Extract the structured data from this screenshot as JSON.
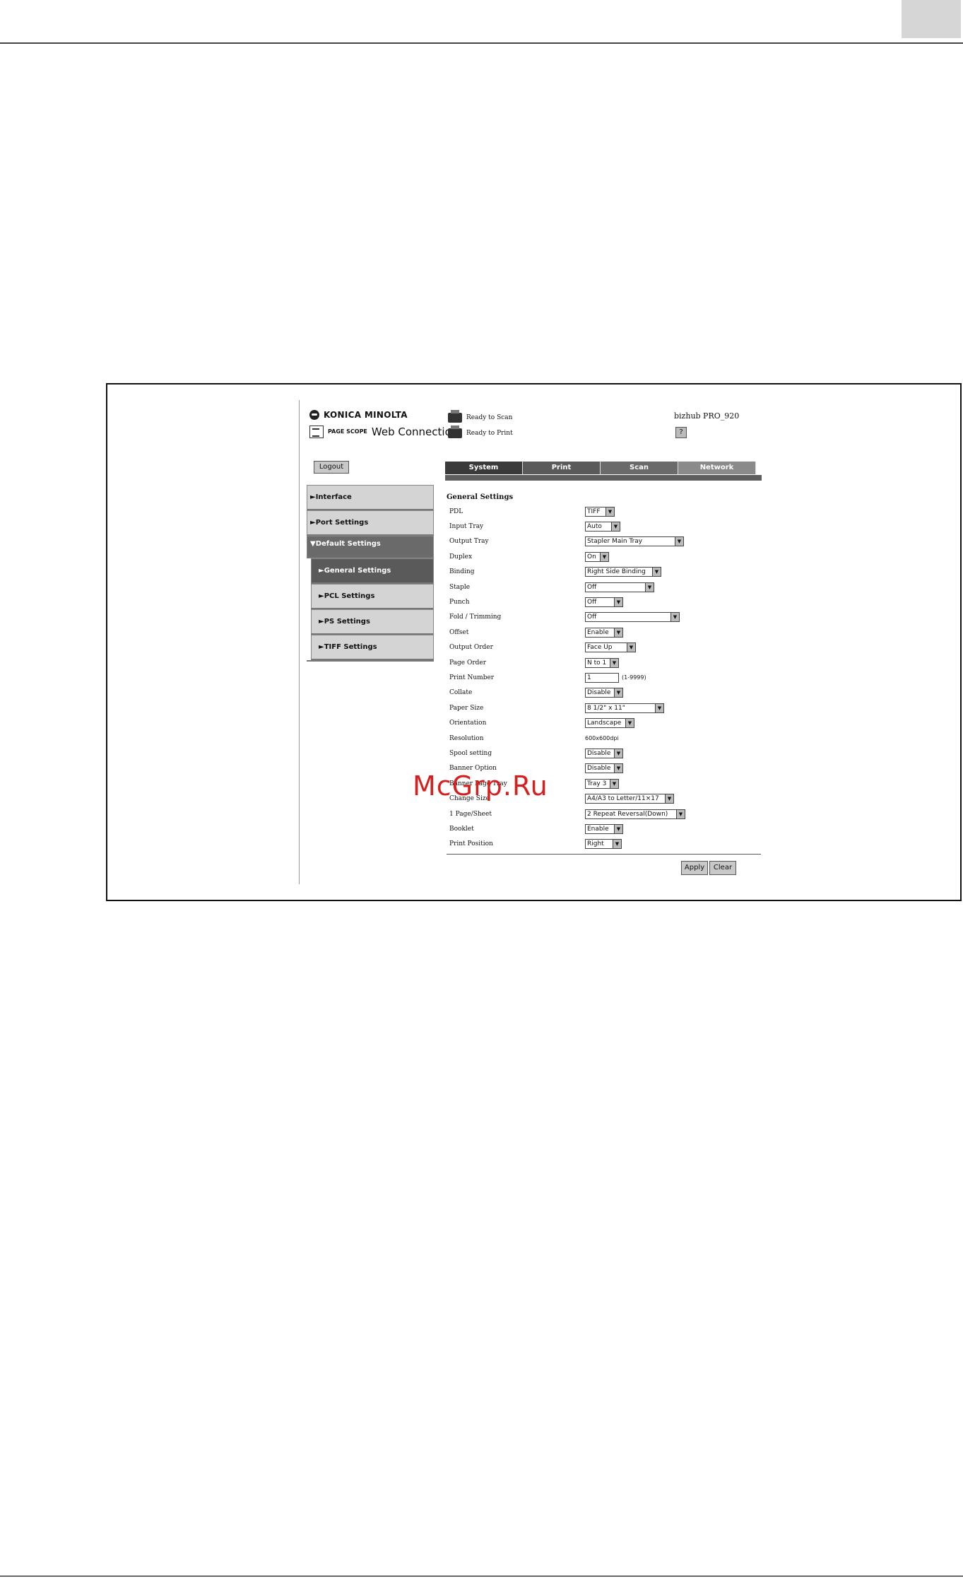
{
  "brand": {
    "company": "KONICA MINOLTA",
    "pagescope": "PAGE SCOPE",
    "product": "Web Connection"
  },
  "status": {
    "scan": "Ready to Scan",
    "print": "Ready to Print"
  },
  "model": "bizhub PRO_920",
  "help_label": "?",
  "logout_label": "Logout",
  "tabs": [
    {
      "label": "System"
    },
    {
      "label": "Print"
    },
    {
      "label": "Scan"
    },
    {
      "label": "Network"
    }
  ],
  "sidebar": {
    "items": [
      {
        "label": "►Interface"
      },
      {
        "label": "►Port Settings"
      },
      {
        "label": "▼Default Settings"
      },
      {
        "label": "►General Settings"
      },
      {
        "label": "►PCL Settings"
      },
      {
        "label": "►PS Settings"
      },
      {
        "label": "►TIFF Settings"
      }
    ]
  },
  "form": {
    "title": "General Settings",
    "rows": [
      {
        "label": "PDL",
        "value": "TIFF"
      },
      {
        "label": "Input Tray",
        "value": "Auto"
      },
      {
        "label": "Output Tray",
        "value": "Stapler Main Tray"
      },
      {
        "label": "Duplex",
        "value": "On"
      },
      {
        "label": "Binding",
        "value": "Right Side Binding"
      },
      {
        "label": "Staple",
        "value": "Off"
      },
      {
        "label": "Punch",
        "value": "Off"
      },
      {
        "label": "Fold / Trimming",
        "value": "Off"
      },
      {
        "label": "Offset",
        "value": "Enable"
      },
      {
        "label": "Output Order",
        "value": "Face Up"
      },
      {
        "label": "Page Order",
        "value": "N to 1"
      },
      {
        "label": "Print Number",
        "value": "1",
        "hint": "(1-9999)"
      },
      {
        "label": "Collate",
        "value": "Disable"
      },
      {
        "label": "Paper Size",
        "value": "8 1/2\" x 11\""
      },
      {
        "label": "Orientation",
        "value": "Landscape"
      },
      {
        "label": "Resolution",
        "value": "600x600dpi"
      },
      {
        "label": "Spool setting",
        "value": "Disable"
      },
      {
        "label": "Banner Option",
        "value": "Disable"
      },
      {
        "label": "Banner Page Tray",
        "value": "Tray 3"
      },
      {
        "label": "Change Size",
        "value": "A4/A3 to Letter/11×17"
      },
      {
        "label": "1 Page/Sheet",
        "value": "2 Repeat Reversal(Down)"
      },
      {
        "label": "Booklet",
        "value": "Enable"
      },
      {
        "label": "Print Position",
        "value": "Right"
      }
    ],
    "apply_label": "Apply",
    "clear_label": "Clear"
  },
  "watermark": "McGrp.Ru"
}
